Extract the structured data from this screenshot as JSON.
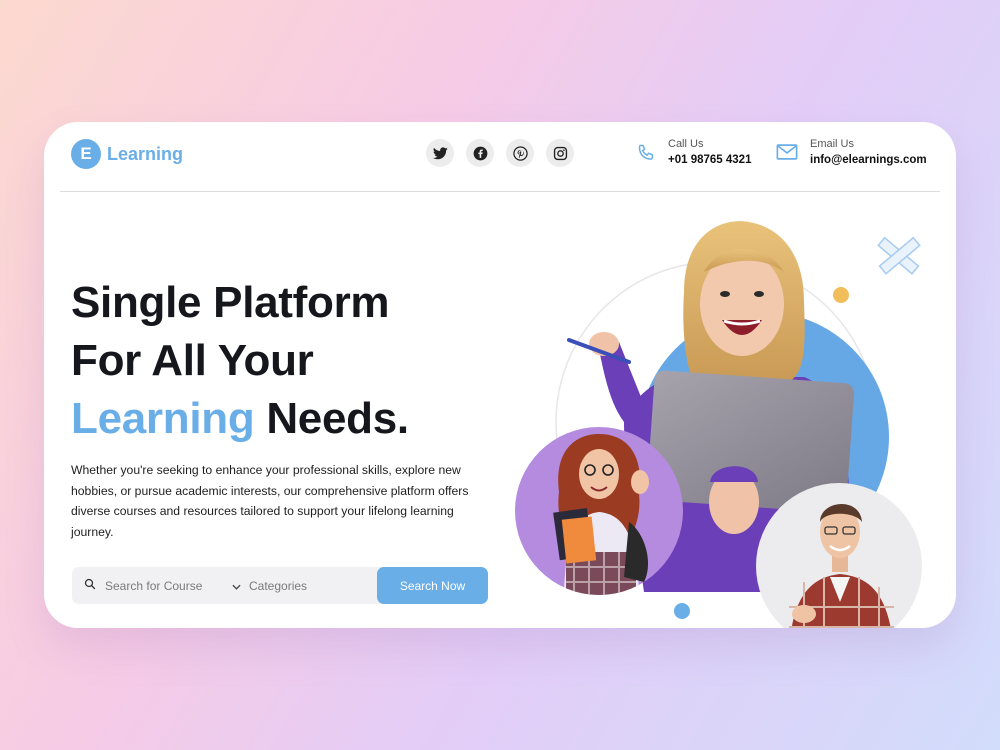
{
  "header": {
    "logo_letter": "E",
    "logo_text": "Learning",
    "socials": [
      {
        "icon": "twitter-icon"
      },
      {
        "icon": "facebook-icon"
      },
      {
        "icon": "pinterest-icon"
      },
      {
        "icon": "instagram-icon"
      }
    ],
    "call": {
      "label": "Call Us",
      "value": "+01 98765 4321"
    },
    "email": {
      "label": "Email Us",
      "value": "info@elearnings.com"
    }
  },
  "hero": {
    "title_line1": "Single Platform",
    "title_line2": "For All Your",
    "title_accent": "Learning",
    "title_end": " Needs.",
    "description": "Whether you're seeking to enhance your professional skills, explore new hobbies, or pursue academic interests, our comprehensive platform offers diverse courses and resources tailored to support your lifelong learning journey."
  },
  "search": {
    "placeholder": "Search for Course",
    "categories_label": "Categories",
    "button_label": "Search Now"
  },
  "colors": {
    "accent": "#6aaee8",
    "background_gradient": [
      "#fcd9cf",
      "#f6cbe6",
      "#e3cdf7",
      "#d2dcfb"
    ],
    "dot_orange": "#f2bd5b",
    "purple": "#b58be0"
  }
}
